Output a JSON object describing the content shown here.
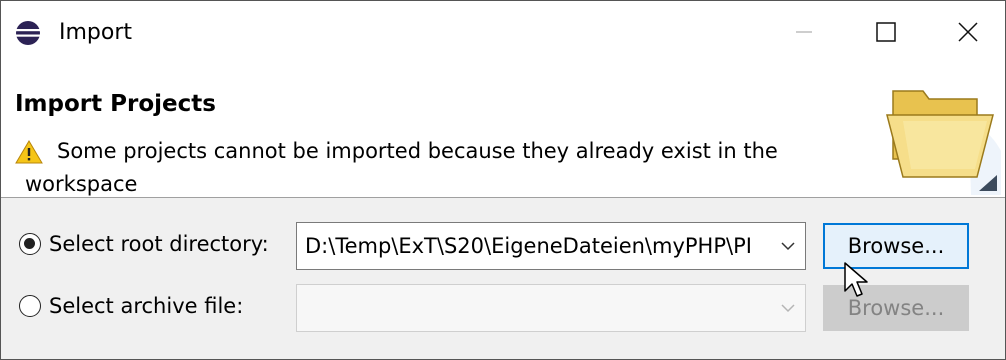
{
  "window": {
    "title": "Import"
  },
  "titlebar": {
    "min_icon": "minimize-icon",
    "max_icon": "maximize-icon",
    "close_icon": "close-icon"
  },
  "banner": {
    "heading": "Import Projects",
    "message": "Some projects cannot be imported because they already exist in the workspace",
    "warning_icon": "warning-icon",
    "art_icon": "open-folder-icon"
  },
  "source": {
    "root_dir": {
      "label": "Select root directory:",
      "selected": true,
      "value": "D:\\Temp\\ExT\\S20\\EigeneDateien\\myPHP\\PI",
      "browse_label": "Browse..."
    },
    "archive": {
      "label": "Select archive file:",
      "selected": false,
      "value": "",
      "browse_label": "Browse..."
    }
  },
  "colors": {
    "focus": "#0078d7",
    "warning": "#f5c518"
  }
}
